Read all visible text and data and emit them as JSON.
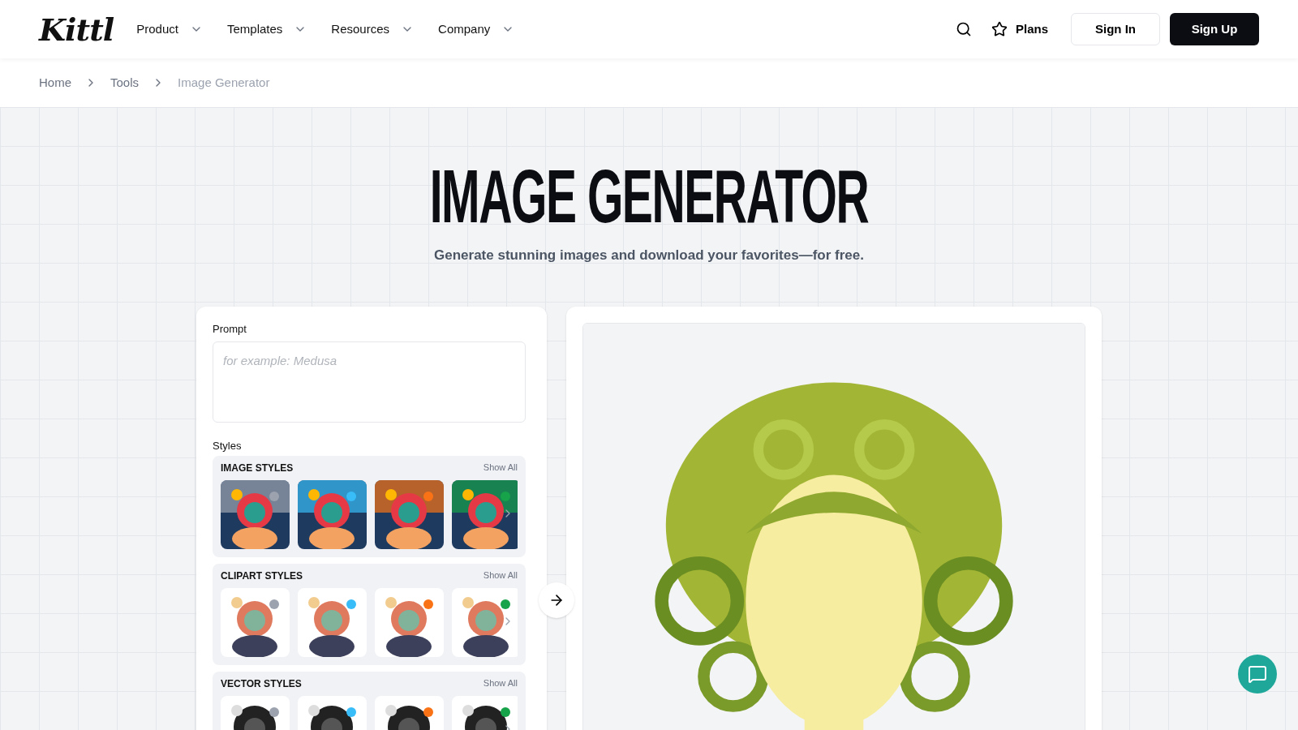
{
  "nav": {
    "logo": "Kittl",
    "menus": [
      {
        "label": "Product"
      },
      {
        "label": "Templates"
      },
      {
        "label": "Resources"
      },
      {
        "label": "Company"
      }
    ],
    "plans": "Plans",
    "sign_in": "Sign In",
    "sign_up": "Sign Up"
  },
  "breadcrumb": [
    {
      "label": "Home",
      "current": false
    },
    {
      "label": "Tools",
      "current": false
    },
    {
      "label": "Image Generator",
      "current": true
    }
  ],
  "hero": {
    "title": "IMAGE GENERATOR",
    "subtitle": "Generate stunning images and download your favorites—for free."
  },
  "form": {
    "prompt_label": "Prompt",
    "prompt_placeholder": "for example: Medusa",
    "styles_label": "Styles",
    "groups": [
      {
        "title": "IMAGE STYLES",
        "show_all": "Show All"
      },
      {
        "title": "CLIPART STYLES",
        "show_all": "Show All"
      },
      {
        "title": "VECTOR STYLES",
        "show_all": "Show All"
      }
    ]
  }
}
